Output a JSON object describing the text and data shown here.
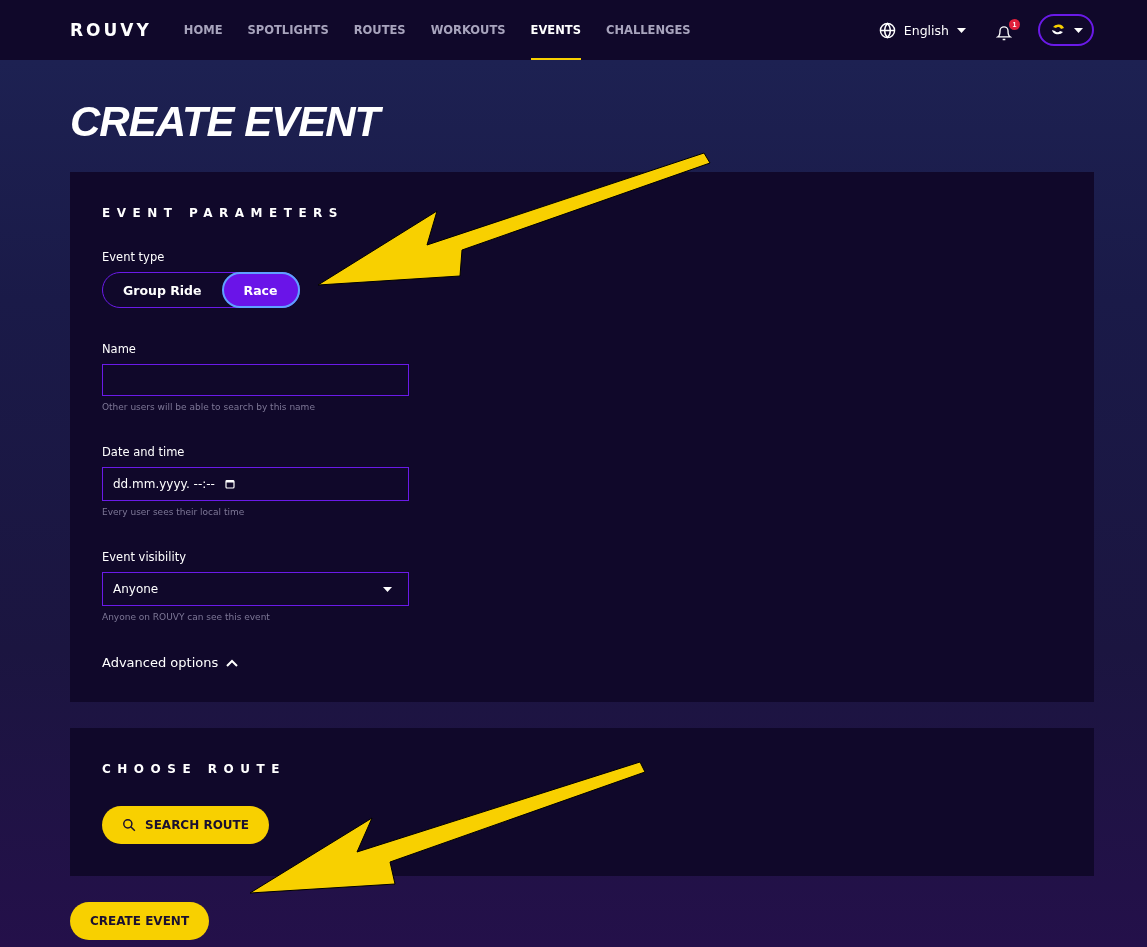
{
  "header": {
    "logo": "ROUVY",
    "nav": [
      {
        "label": "HOME",
        "selected": false
      },
      {
        "label": "SPOTLIGHTS",
        "selected": false
      },
      {
        "label": "ROUTES",
        "selected": false
      },
      {
        "label": "WORKOUTS",
        "selected": false
      },
      {
        "label": "EVENTS",
        "selected": true
      },
      {
        "label": "CHALLENGES",
        "selected": false
      }
    ],
    "language": "English",
    "notification_count": "1"
  },
  "title": "CREATE EVENT",
  "event_parameters": {
    "heading": "EVENT PARAMETERS",
    "event_type": {
      "label": "Event type",
      "options": [
        {
          "label": "Group Ride",
          "selected": false
        },
        {
          "label": "Race",
          "selected": true
        }
      ]
    },
    "fields": [
      {
        "kind": "text",
        "label": "Name",
        "hint": "Other users will be able to search by this name"
      },
      {
        "kind": "date",
        "label": "Date and time",
        "value": "dd.mm.yyyy. --:--",
        "hint": "Every user sees their local time"
      },
      {
        "kind": "select",
        "label": "Event visibility",
        "value": "Anyone",
        "hint": "Anyone on ROUVY can see this event"
      }
    ],
    "advanced": {
      "label": "Advanced options",
      "expanded": true
    }
  },
  "choose_route": {
    "heading": "CHOOSE ROUTE",
    "button": "SEARCH ROUTE"
  },
  "submit": "CREATE EVENT"
}
